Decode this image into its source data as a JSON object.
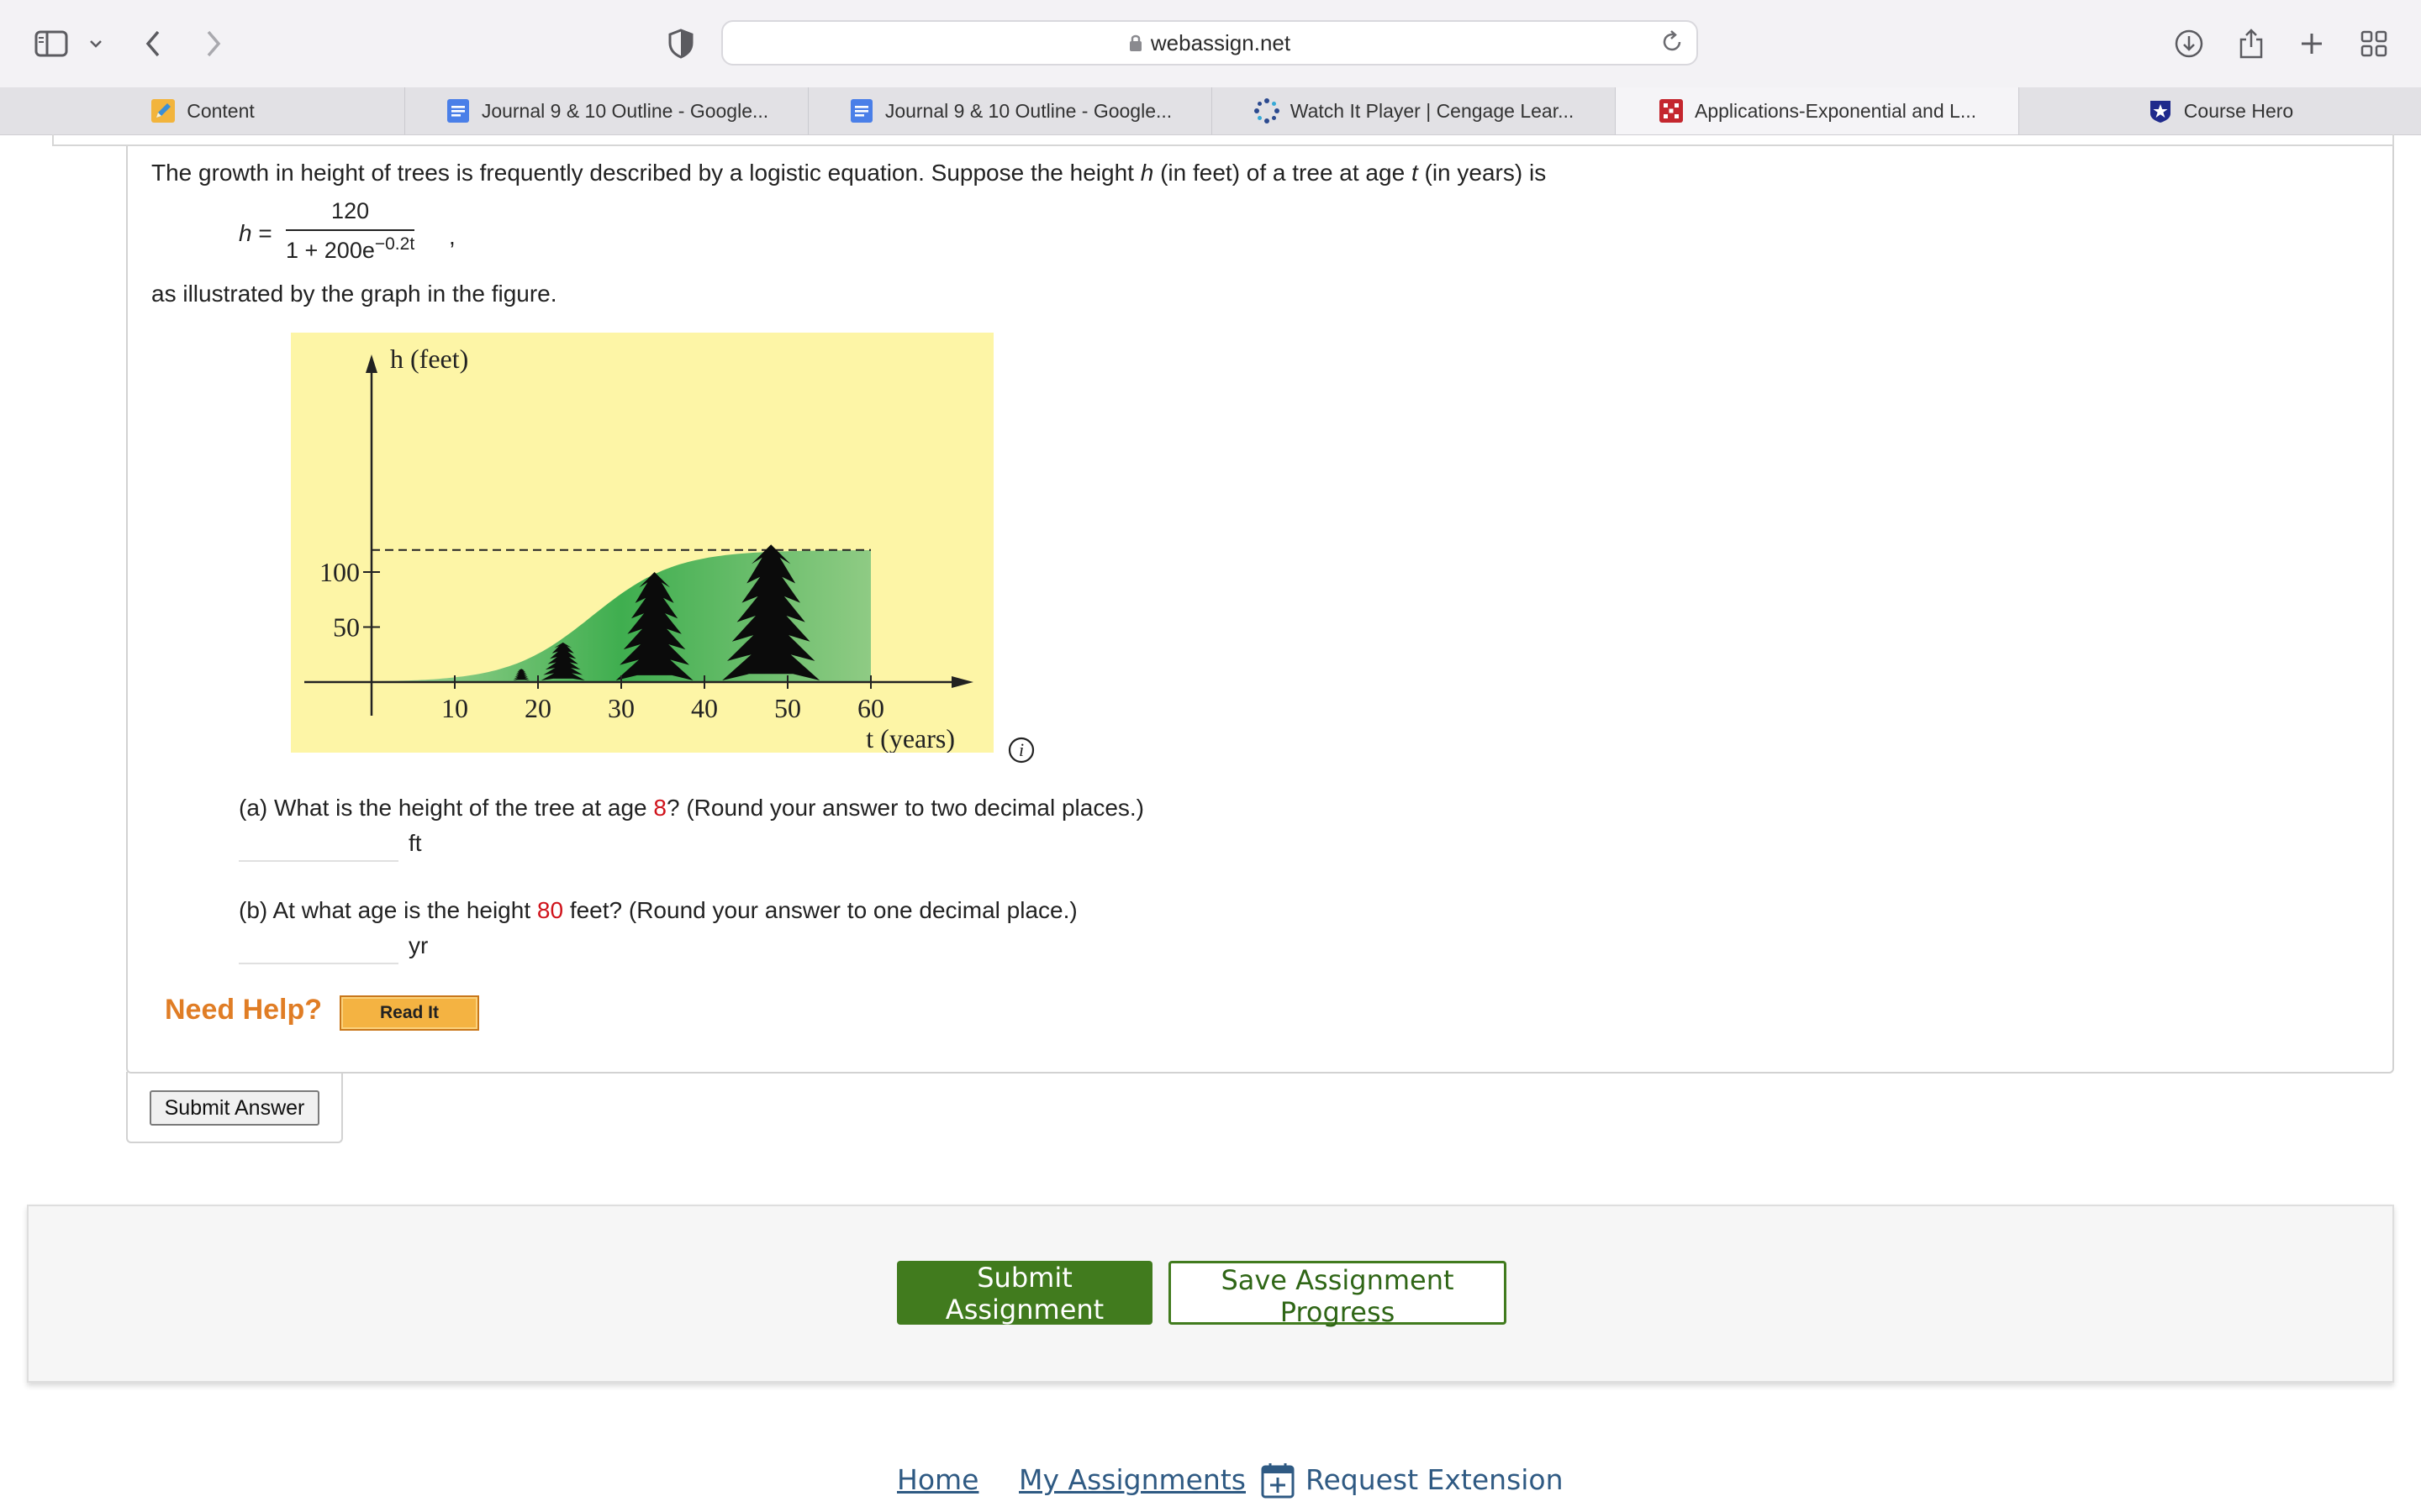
{
  "browser": {
    "url": "webassign.net",
    "tabs": [
      {
        "label": "Content",
        "icon": "pencil-icon",
        "active": false
      },
      {
        "label": "Journal 9 & 10 Outline - Google...",
        "icon": "google-docs-icon",
        "active": false
      },
      {
        "label": "Journal 9 & 10 Outline - Google...",
        "icon": "google-docs-icon",
        "active": false
      },
      {
        "label": "Watch It Player | Cengage Lear...",
        "icon": "cengage-icon",
        "active": false
      },
      {
        "label": "Applications-Exponential and L...",
        "icon": "webassign-icon",
        "active": true
      },
      {
        "label": "Course Hero",
        "icon": "course-hero-icon",
        "active": false
      }
    ]
  },
  "question": {
    "intro_1": "The growth in height of trees is frequently described by a logistic equation. Suppose the height ",
    "var_h": "h",
    "intro_2": " (in feet) of a tree at age ",
    "var_t": "t",
    "intro_3": " (in years) is",
    "formula_lhs": "h =",
    "formula_num": "120",
    "formula_den": "1 + 200e",
    "formula_exp": "−0.2t",
    "formula_tail": ",",
    "after_formula": "as illustrated by the graph in the figure.",
    "part_a_1": "(a) What is the height of the tree at age ",
    "part_a_value": "8",
    "part_a_2": "? (Round your answer to two decimal places.)",
    "part_a_unit": "ft",
    "part_a_answer": "",
    "part_b_1": "(b) At what age is the height ",
    "part_b_value": "80",
    "part_b_2": " feet? (Round your answer to one decimal place.)",
    "part_b_unit": "yr",
    "part_b_answer": "",
    "need_help": "Need Help?",
    "read_it": "Read It",
    "submit_answer": "Submit Answer"
  },
  "figure": {
    "y_label": "h (feet)",
    "x_label": "t (years)",
    "y_ticks": [
      "100",
      "50"
    ],
    "x_ticks": [
      "10",
      "20",
      "30",
      "40",
      "50",
      "60"
    ],
    "background_color": "#fdf5a6",
    "fill_color": "#3fae4f",
    "asymptote": 120
  },
  "actions": {
    "submit_assignment": "Submit Assignment",
    "save_progress": "Save Assignment Progress"
  },
  "footer": {
    "home": "Home",
    "my_assignments": "My Assignments",
    "request_extension": "Request Extension"
  },
  "colors": {
    "accent_green": "#417b1e",
    "link_blue": "#2f5a83",
    "need_help_orange": "#e07d25",
    "highlight_red": "#d0131b"
  }
}
